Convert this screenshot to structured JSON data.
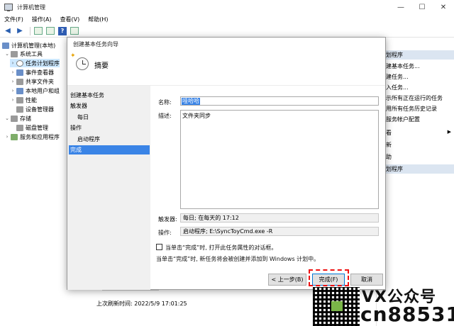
{
  "window": {
    "title": "计算机管理",
    "controls": {
      "minimize": "—",
      "maximize": "☐",
      "close": "✕"
    }
  },
  "menu": [
    "文件(F)",
    "操作(A)",
    "查看(V)",
    "帮助(H)"
  ],
  "tree": {
    "root": "计算机管理(本地)",
    "items": [
      "系统工具",
      "任务计划程序",
      "事件查看器",
      "共享文件夹",
      "本地用户和组",
      "性能",
      "设备管理器",
      "存储",
      "磁盘管理",
      "服务和应用程序"
    ]
  },
  "actions": {
    "header": "划程序",
    "items": [
      "建基本任务...",
      "建任务...",
      "入任务...",
      "示所有正在运行的任务",
      "用所有任务历史记录",
      "服务帐户配置",
      "看",
      "新",
      "助",
      "划程序"
    ]
  },
  "status": {
    "last_run": "上次刷新时间: 2022/5/9 17:01:25"
  },
  "dialog": {
    "title": "创建基本任务向导",
    "heading": "摘要",
    "steps": [
      "创建基本任务",
      "触发器",
      "每日",
      "操作",
      "启动程序",
      "完成"
    ],
    "name_label": "名称:",
    "name_value": "哇哈哈",
    "desc_label": "描述:",
    "desc_value": "文件夹同步",
    "trigger_label": "触发器:",
    "trigger_value": "每日; 在每天的 17:12",
    "action_label": "操作:",
    "action_value": "启动程序; E:\\SyncToyCmd.exe -R",
    "checkbox_label": "当单击“完成”时, 打开此任务属性的对话框。",
    "note": "当单击“完成”时, 新任务将会被创建并添加到 Windows 计划中。",
    "btn_back": "< 上一步(B)",
    "btn_finish": "完成(F)",
    "btn_cancel": "取消"
  },
  "watermark": {
    "line1": "VX公众号",
    "line2": "cn88531"
  }
}
